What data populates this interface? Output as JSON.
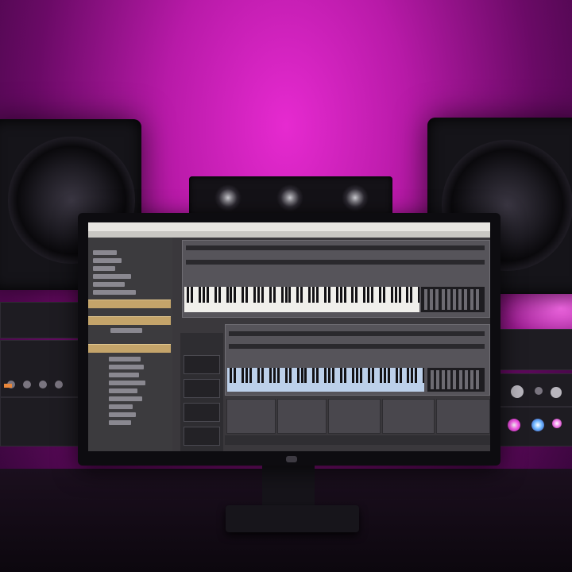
{
  "scene": {
    "description_items": [
      "left-speaker",
      "right-speaker",
      "center-speaker",
      "monitor",
      "rack-gear"
    ],
    "wall_color": "#c21fb8"
  },
  "daw": {
    "menu_title": "",
    "sidebar": {
      "heading": "",
      "tab_labels": [
        "",
        "",
        ""
      ]
    },
    "status_left": "",
    "status_right": ""
  }
}
